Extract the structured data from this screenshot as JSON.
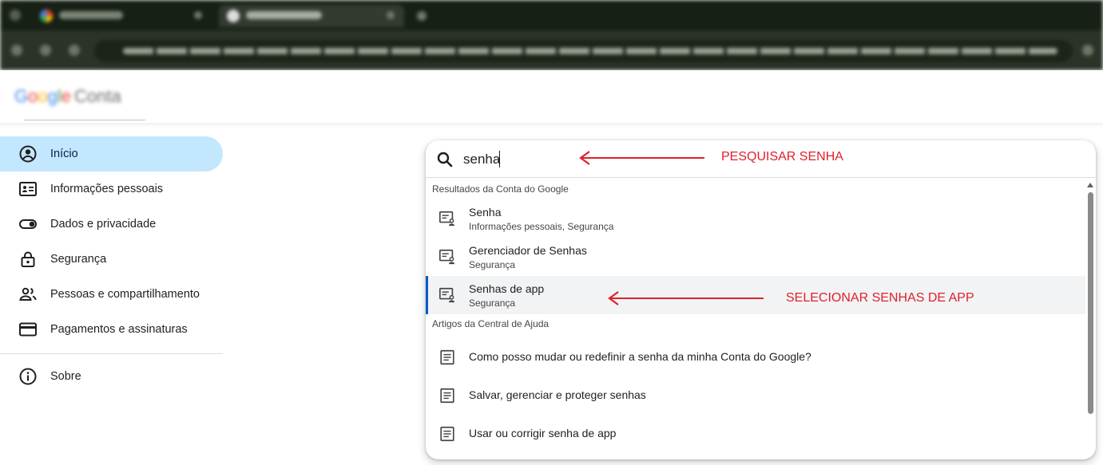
{
  "search": {
    "value": "senha"
  },
  "sidebar": {
    "items": [
      {
        "label": "Início",
        "icon": "account-circle-icon"
      },
      {
        "label": "Informações pessoais",
        "icon": "id-card-icon"
      },
      {
        "label": "Dados e privacidade",
        "icon": "toggle-icon"
      },
      {
        "label": "Segurança",
        "icon": "lock-icon"
      },
      {
        "label": "Pessoas e compartilhamento",
        "icon": "people-icon"
      },
      {
        "label": "Pagamentos e assinaturas",
        "icon": "credit-card-icon"
      }
    ],
    "about": {
      "label": "Sobre",
      "icon": "info-icon"
    }
  },
  "results": {
    "account_heading": "Resultados da Conta do Google",
    "account_items": [
      {
        "title": "Senha",
        "subtitle": "Informações pessoais, Segurança"
      },
      {
        "title": "Gerenciador de Senhas",
        "subtitle": "Segurança"
      },
      {
        "title": "Senhas de app",
        "subtitle": "Segurança"
      }
    ],
    "help_heading": "Artigos da Central de Ajuda",
    "help_items": [
      {
        "title": "Como posso mudar ou redefinir a senha da minha Conta do Google?"
      },
      {
        "title": "Salvar, gerenciar e proteger senhas"
      },
      {
        "title": "Usar ou corrigir senha de app"
      }
    ]
  },
  "annotations": {
    "search_note": "PESQUISAR SENHA",
    "select_note": "SELECIONAR SENHAS DE APP",
    "color": "#e0212c"
  },
  "colors": {
    "active_nav": "#c2e7ff",
    "selected_accent": "#0b57d0"
  }
}
